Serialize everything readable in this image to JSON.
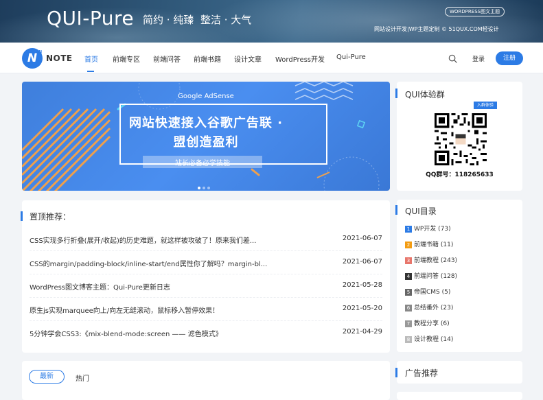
{
  "banner": {
    "title": "QUI-Pure",
    "slogan1": "简约 · 纯臻",
    "slogan2": "整洁 · 大气",
    "badge": "WORDPRESS图文主题",
    "subline": "网站设计开发|WP主题定制 © 51QUX.COM轻设计"
  },
  "nav": {
    "logo_mark": "N",
    "logo_sup": "UI",
    "logo_text": "NOTE",
    "items": [
      "首页",
      "前端专区",
      "前端问答",
      "前端书籍",
      "设计文章",
      "WordPress开发",
      "Qui-Pure"
    ],
    "login": "登录",
    "register": "注册",
    "accent": "#2c7be5"
  },
  "slider": {
    "brand": "Google AdSense",
    "headline1": "网站快速接入谷歌广告联 ·",
    "headline2": "盟创造盈利",
    "tag": "站长必备必学技能",
    "slide_count": 3,
    "active_slide": 1
  },
  "pinned": {
    "title": "置顶推荐：",
    "rows": [
      {
        "title": "CSS实现多行折叠(展开/收起)的历史难题，就这样被攻破了！原来我们差...",
        "date": "2021-06-07"
      },
      {
        "title": "CSS的margin/padding-block/inline-start/end属性你了解吗？margin-bl...",
        "date": "2021-06-07"
      },
      {
        "title": "WordPress图文博客主题：Qui-Pure更新日志",
        "date": "2021-05-28"
      },
      {
        "title": "原生js实现marquee向上/向左无缝滚动，鼠标移入暂停效果！",
        "date": "2021-05-20"
      },
      {
        "title": "5分钟学会CSS3:《mix-blend-mode:screen —— 滤色模式》",
        "date": "2021-04-29"
      }
    ]
  },
  "tabs": {
    "latest": "最新",
    "hot": "热门"
  },
  "sidebar": {
    "qq_title": "QUI体验群",
    "join_badge": "入群体验",
    "qq_number": "QQ群号：118265633",
    "cat_title": "QUI目录",
    "categories": [
      {
        "num": "1",
        "label": "WP开发 (73)",
        "color": "#2c7be5"
      },
      {
        "num": "2",
        "label": "前端书籍 (11)",
        "color": "#f39c12"
      },
      {
        "num": "3",
        "label": "前端教程 (243)",
        "color": "#e8766b"
      },
      {
        "num": "4",
        "label": "前端问答 (128)",
        "color": "#333333"
      },
      {
        "num": "5",
        "label": "帝国CMS (5)",
        "color": "#666666"
      },
      {
        "num": "6",
        "label": "总结番外 (23)",
        "color": "#888888"
      },
      {
        "num": "7",
        "label": "教程分享 (6)",
        "color": "#999999"
      },
      {
        "num": "8",
        "label": "设计教程 (14)",
        "color": "#bbbbbb"
      }
    ],
    "ad_title": "广告推荐"
  }
}
